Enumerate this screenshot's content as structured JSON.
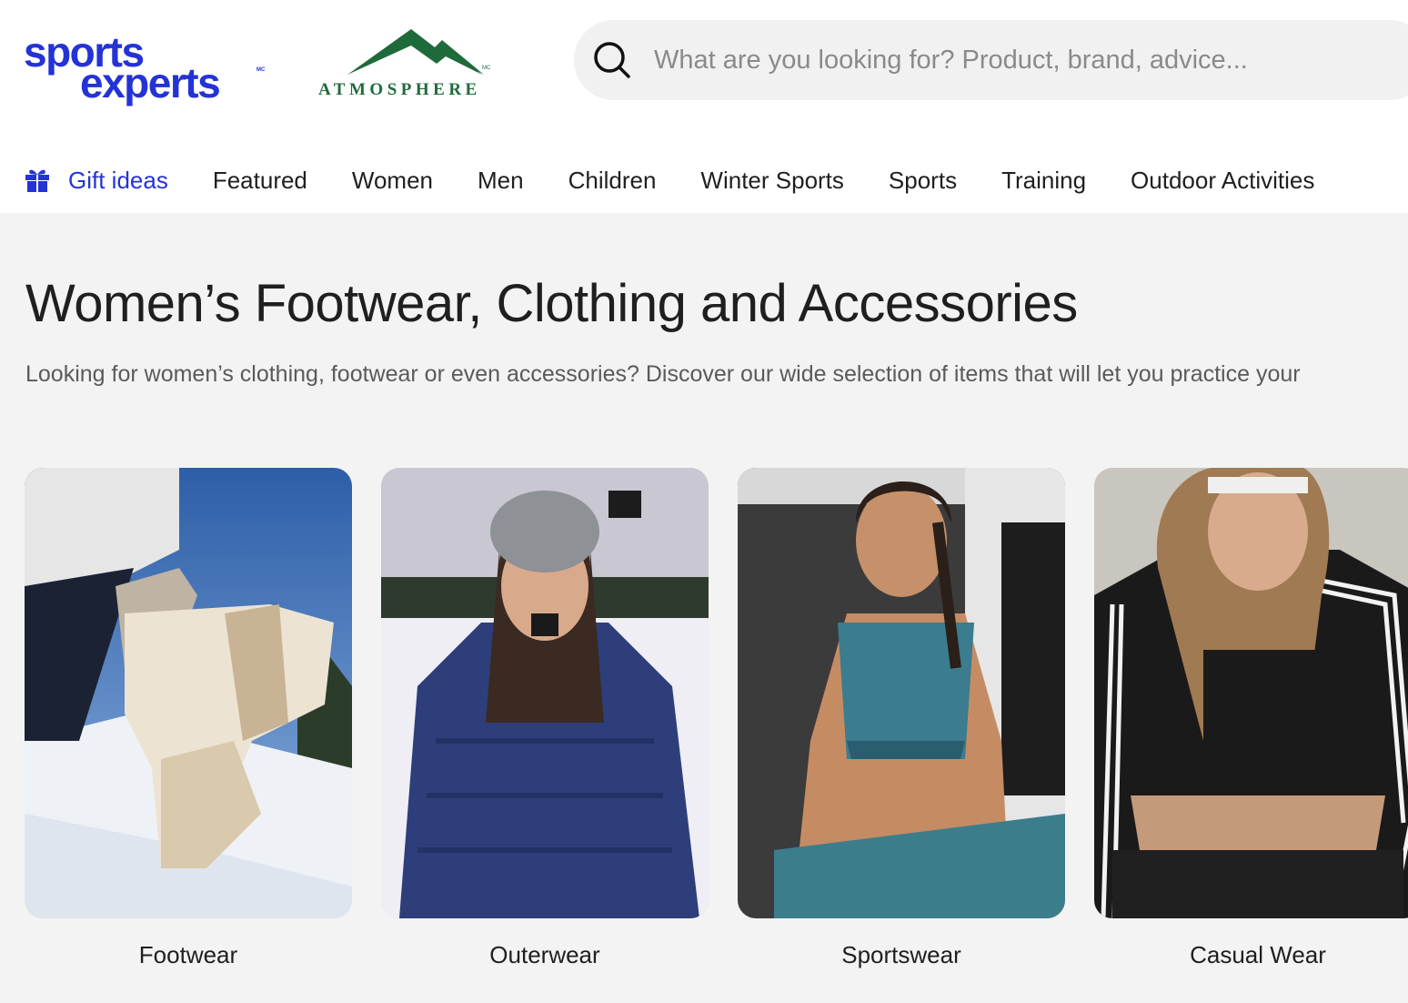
{
  "brand": {
    "sports_experts_line1": "sports",
    "sports_experts_line2": "experts",
    "sports_experts_mark": "MC",
    "atmosphere": "ATMOSPHERE",
    "atmosphere_mark": "MC",
    "colors": {
      "sports_experts_blue": "#2433d6",
      "atmosphere_green": "#1f6a3a"
    }
  },
  "search": {
    "placeholder": "What are you looking for? Product, brand, advice...",
    "icon": "search-icon"
  },
  "nav": {
    "items": [
      {
        "label": "Gift ideas",
        "icon": "gift-icon",
        "highlighted": true
      },
      {
        "label": "Featured"
      },
      {
        "label": "Women"
      },
      {
        "label": "Men"
      },
      {
        "label": "Children"
      },
      {
        "label": "Winter Sports"
      },
      {
        "label": "Sports"
      },
      {
        "label": "Training"
      },
      {
        "label": "Outdoor Activities"
      }
    ]
  },
  "main": {
    "title": "Women’s Footwear, Clothing and Accessories",
    "subtitle": "Looking for women’s clothing, footwear or even accessories? Discover our wide selection of items that will let you practice your",
    "categories": [
      {
        "label": "Footwear"
      },
      {
        "label": "Outerwear"
      },
      {
        "label": "Sportswear"
      },
      {
        "label": "Casual Wear"
      }
    ]
  }
}
